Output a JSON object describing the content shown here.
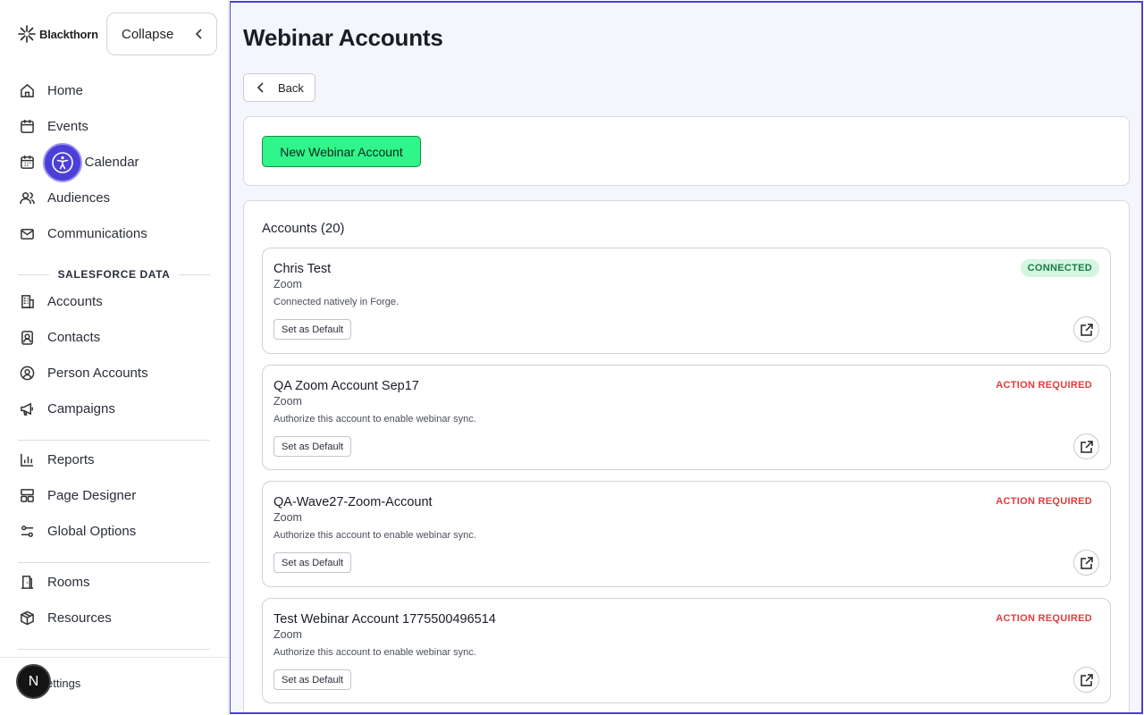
{
  "brand": {
    "name": "Blackthorn"
  },
  "sidebar": {
    "collapse_label": "Collapse",
    "nav": [
      {
        "label": "Home",
        "icon": "home-icon"
      },
      {
        "label": "Events",
        "icon": "calendar-icon"
      },
      {
        "label": "s Calendar",
        "icon": "calendar-grid-icon"
      },
      {
        "label": "Audiences",
        "icon": "users-icon"
      },
      {
        "label": "Communications",
        "icon": "mail-icon"
      }
    ],
    "section_title": "SALESFORCE DATA",
    "sf_nav": [
      {
        "label": "Accounts",
        "icon": "building-icon"
      },
      {
        "label": "Contacts",
        "icon": "contact-card-icon"
      },
      {
        "label": "Person Accounts",
        "icon": "user-circle-icon"
      },
      {
        "label": "Campaigns",
        "icon": "megaphone-icon"
      }
    ],
    "tools_nav": [
      {
        "label": "Reports",
        "icon": "bar-chart-icon"
      },
      {
        "label": "Page Designer",
        "icon": "layout-icon"
      },
      {
        "label": "Global Options",
        "icon": "sliders-icon"
      }
    ],
    "venue_nav": [
      {
        "label": "Rooms",
        "icon": "door-icon"
      },
      {
        "label": "Resources",
        "icon": "box-icon"
      }
    ],
    "settings_label": "ettings",
    "avatar_initial": "N"
  },
  "main": {
    "title": "Webinar Accounts",
    "back_label": "Back",
    "new_button_label": "New Webinar Account",
    "accounts_heading": "Accounts (20)",
    "set_default_label": "Set as Default",
    "accounts": [
      {
        "name": "Chris Test",
        "provider": "Zoom",
        "description": "Connected natively in Forge.",
        "status": "CONNECTED"
      },
      {
        "name": "QA Zoom Account Sep17",
        "provider": "Zoom",
        "description": "Authorize this account to enable webinar sync.",
        "status": "ACTION REQUIRED"
      },
      {
        "name": "QA-Wave27-Zoom-Account",
        "provider": "Zoom",
        "description": "Authorize this account to enable webinar sync.",
        "status": "ACTION REQUIRED"
      },
      {
        "name": "Test Webinar Account 1775500496514",
        "provider": "Zoom",
        "description": "Authorize this account to enable webinar sync.",
        "status": "ACTION REQUIRED"
      }
    ]
  },
  "colors": {
    "accent": "#4b3fd9",
    "new_button": "#2ff58a",
    "connected_bg": "#d4f6e1",
    "action_required": "#e23b3b"
  }
}
